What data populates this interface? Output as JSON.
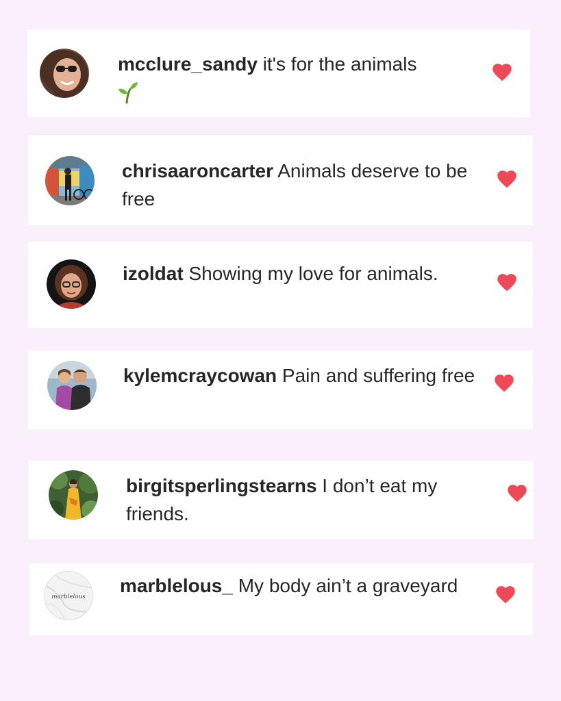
{
  "colors": {
    "background": "#f9f0fb",
    "card": "#ffffff",
    "text": "#262626",
    "heart": "#ed4956"
  },
  "comments": [
    {
      "username": "mcclure_sandy",
      "text": "it's for the animals",
      "emoji": "seedling-emoji",
      "liked": true
    },
    {
      "username": "chrisaaroncarter",
      "text": "Animals deserve to be free",
      "liked": true
    },
    {
      "username": "izoldat",
      "text": "Showing my love for animals.",
      "liked": true
    },
    {
      "username": "kylemcraycowan",
      "text": "Pain and suffering free",
      "liked": true
    },
    {
      "username": "birgitsperlingstearns",
      "text": "I don’t eat my friends.",
      "liked": true
    },
    {
      "username": "marblelous_",
      "text": "My body ain’t a graveyard",
      "avatar_text": "marblelous",
      "liked": true
    }
  ]
}
